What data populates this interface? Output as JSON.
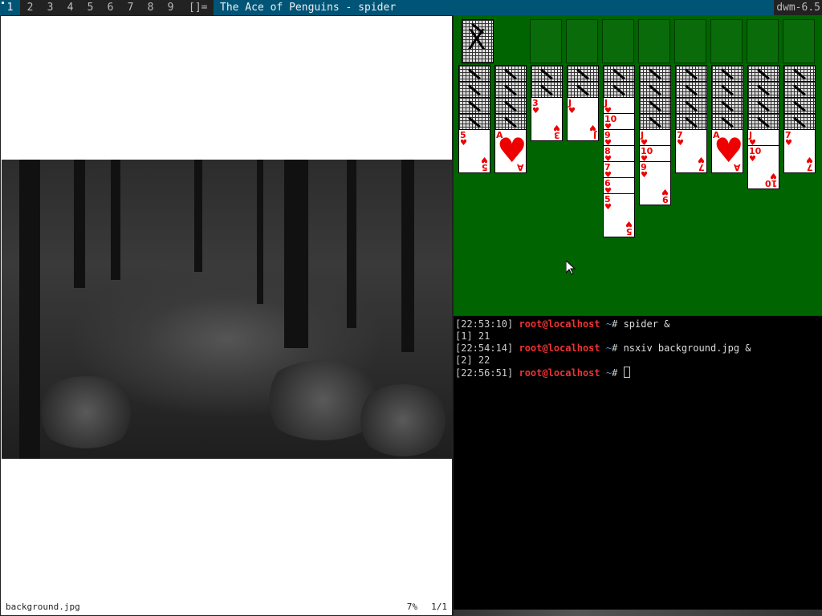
{
  "bar": {
    "tags": [
      "1",
      "2",
      "3",
      "4",
      "5",
      "6",
      "7",
      "8",
      "9"
    ],
    "selected_tag": "1",
    "layout_symbol": "[]=",
    "window_title": "The Ace of Penguins - spider",
    "status": "dwm-6.5"
  },
  "nsxiv": {
    "filename": "background.jpg",
    "zoom": "7%",
    "page": "1/1"
  },
  "spider": {
    "stock_symbol": "X",
    "columns": [
      {
        "hidden": 4,
        "face_up": [
          {
            "rank": "5",
            "suit": "♥"
          }
        ]
      },
      {
        "hidden": 4,
        "face_up": [
          {
            "rank": "A",
            "suit": "♥"
          }
        ]
      },
      {
        "hidden": 2,
        "face_up": [
          {
            "rank": "3",
            "suit": "♥"
          }
        ]
      },
      {
        "hidden": 2,
        "face_up": [
          {
            "rank": "J",
            "suit": "♥"
          }
        ]
      },
      {
        "hidden": 2,
        "face_up": [
          {
            "rank": "J",
            "suit": "♥"
          },
          {
            "rank": "10",
            "suit": "♥"
          },
          {
            "rank": "9",
            "suit": "♥"
          },
          {
            "rank": "8",
            "suit": "♥"
          },
          {
            "rank": "7",
            "suit": "♥"
          },
          {
            "rank": "6",
            "suit": "♥"
          },
          {
            "rank": "5",
            "suit": "♥"
          }
        ]
      },
      {
        "hidden": 4,
        "face_up": [
          {
            "rank": "J",
            "suit": "♥"
          },
          {
            "rank": "10",
            "suit": "♥"
          },
          {
            "rank": "9",
            "suit": "♥"
          }
        ]
      },
      {
        "hidden": 4,
        "face_up": [
          {
            "rank": "7",
            "suit": "♥"
          }
        ]
      },
      {
        "hidden": 4,
        "face_up": [
          {
            "rank": "A",
            "suit": "♥"
          }
        ]
      },
      {
        "hidden": 4,
        "face_up": [
          {
            "rank": "J",
            "suit": "♥"
          },
          {
            "rank": "10",
            "suit": "♥"
          }
        ]
      },
      {
        "hidden": 4,
        "face_up": [
          {
            "rank": "7",
            "suit": "♥"
          }
        ]
      }
    ]
  },
  "terminal": {
    "lines": [
      {
        "time": "[22:53:10]",
        "user": "root@localhost",
        "path": "~",
        "prompt": "#",
        "cmd": " spider &"
      },
      {
        "plain": "[1] 21"
      },
      {
        "time": "[22:54:14]",
        "user": "root@localhost",
        "path": "~",
        "prompt": "#",
        "cmd": " nsxiv background.jpg &"
      },
      {
        "plain": "[2] 22"
      },
      {
        "time": "[22:56:51]",
        "user": "root@localhost",
        "path": "~",
        "prompt": "#",
        "cmd": " ",
        "cursor": true
      }
    ]
  },
  "colors": {
    "bar_bg": "#222222",
    "accent": "#005577",
    "felt": "#006400",
    "card_red": "#e00000",
    "prompt_user": "#e33333",
    "prompt_path": "#5a8fd0"
  }
}
